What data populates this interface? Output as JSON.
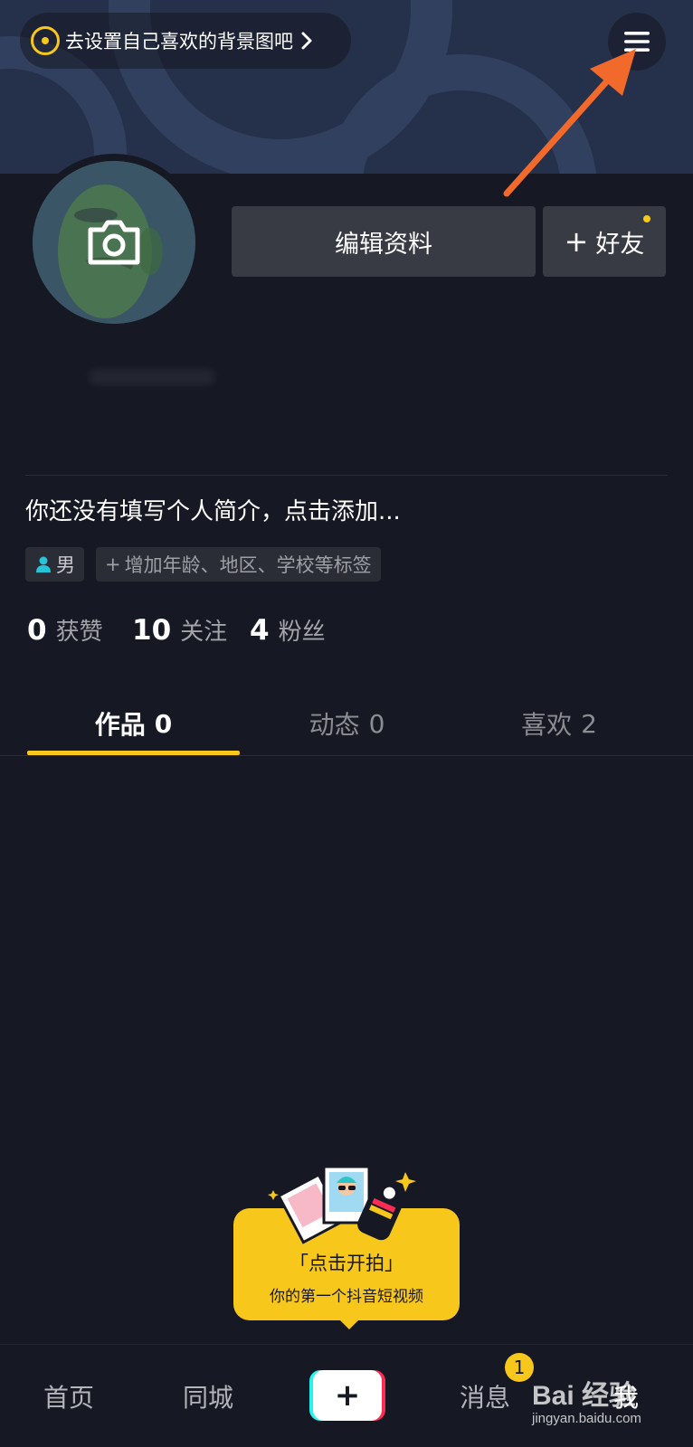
{
  "header": {
    "bg_prompt": "去设置自己喜欢的背景图吧",
    "menu_icon": "hamburger-menu-icon"
  },
  "profile": {
    "edit_label": "编辑资料",
    "add_friend_label": "好友",
    "bio": "你还没有填写个人简介，点击添加...",
    "tags": {
      "gender": "男",
      "add_tags": "增加年龄、地区、学校等标签"
    },
    "stats": [
      {
        "num": "0",
        "label": "获赞"
      },
      {
        "num": "10",
        "label": "关注"
      },
      {
        "num": "4",
        "label": "粉丝"
      }
    ]
  },
  "tabs": [
    {
      "label": "作品",
      "count": "0",
      "active": true
    },
    {
      "label": "动态",
      "count": "0",
      "active": false
    },
    {
      "label": "喜欢",
      "count": "2",
      "active": false
    }
  ],
  "shoot_card": {
    "title": "「点击开拍」",
    "subtitle": "你的第一个抖音短视频"
  },
  "bottom_nav": {
    "home": "首页",
    "nearby": "同城",
    "add": "+",
    "messages": "消息",
    "messages_badge": "1",
    "me": "我"
  },
  "watermark": {
    "logo": "Bai 经验",
    "url": "jingyan.baidu.com"
  },
  "colors": {
    "background": "#161823",
    "accent": "#f8c71b",
    "button": "#393b44",
    "arrow": "#f26a2b"
  }
}
